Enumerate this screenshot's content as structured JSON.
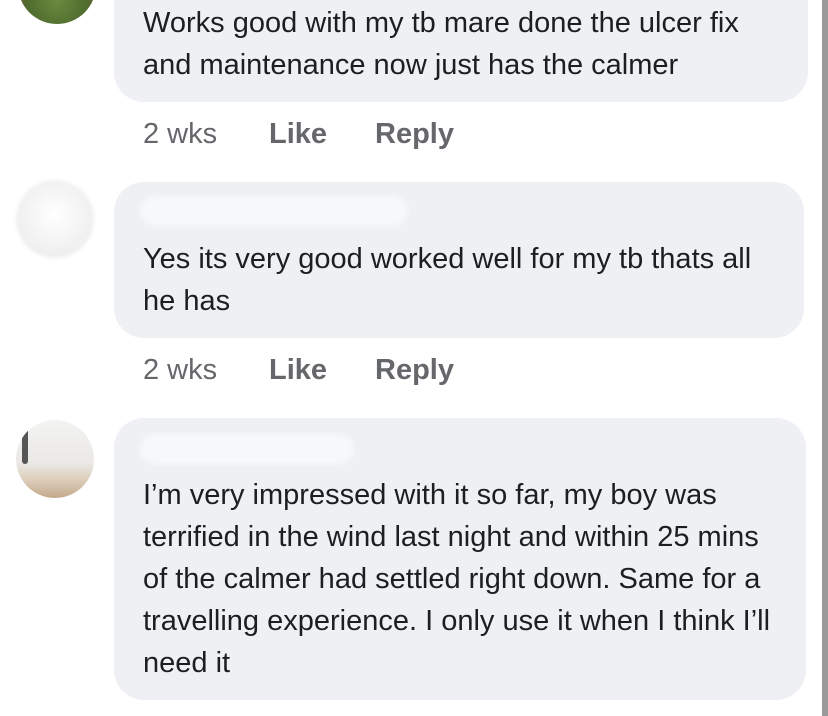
{
  "comments": [
    {
      "text": "Works good with my tb mare done the ulcer fix and maintenance now just has the calmer",
      "time": "2 wks",
      "like_label": "Like",
      "reply_label": "Reply"
    },
    {
      "text": "Yes its very good worked well for my tb thats all he has",
      "time": "2 wks",
      "like_label": "Like",
      "reply_label": "Reply"
    },
    {
      "text": "I’m very impressed with it so far, my boy was terrified in the wind last night and within 25 mins of the calmer had settled right down. Same for a travelling experience. I only use it when I think I’ll need it"
    }
  ],
  "colors": {
    "bubble_bg": "#eff0f4",
    "text": "#1c1e21",
    "meta": "#65676b"
  }
}
